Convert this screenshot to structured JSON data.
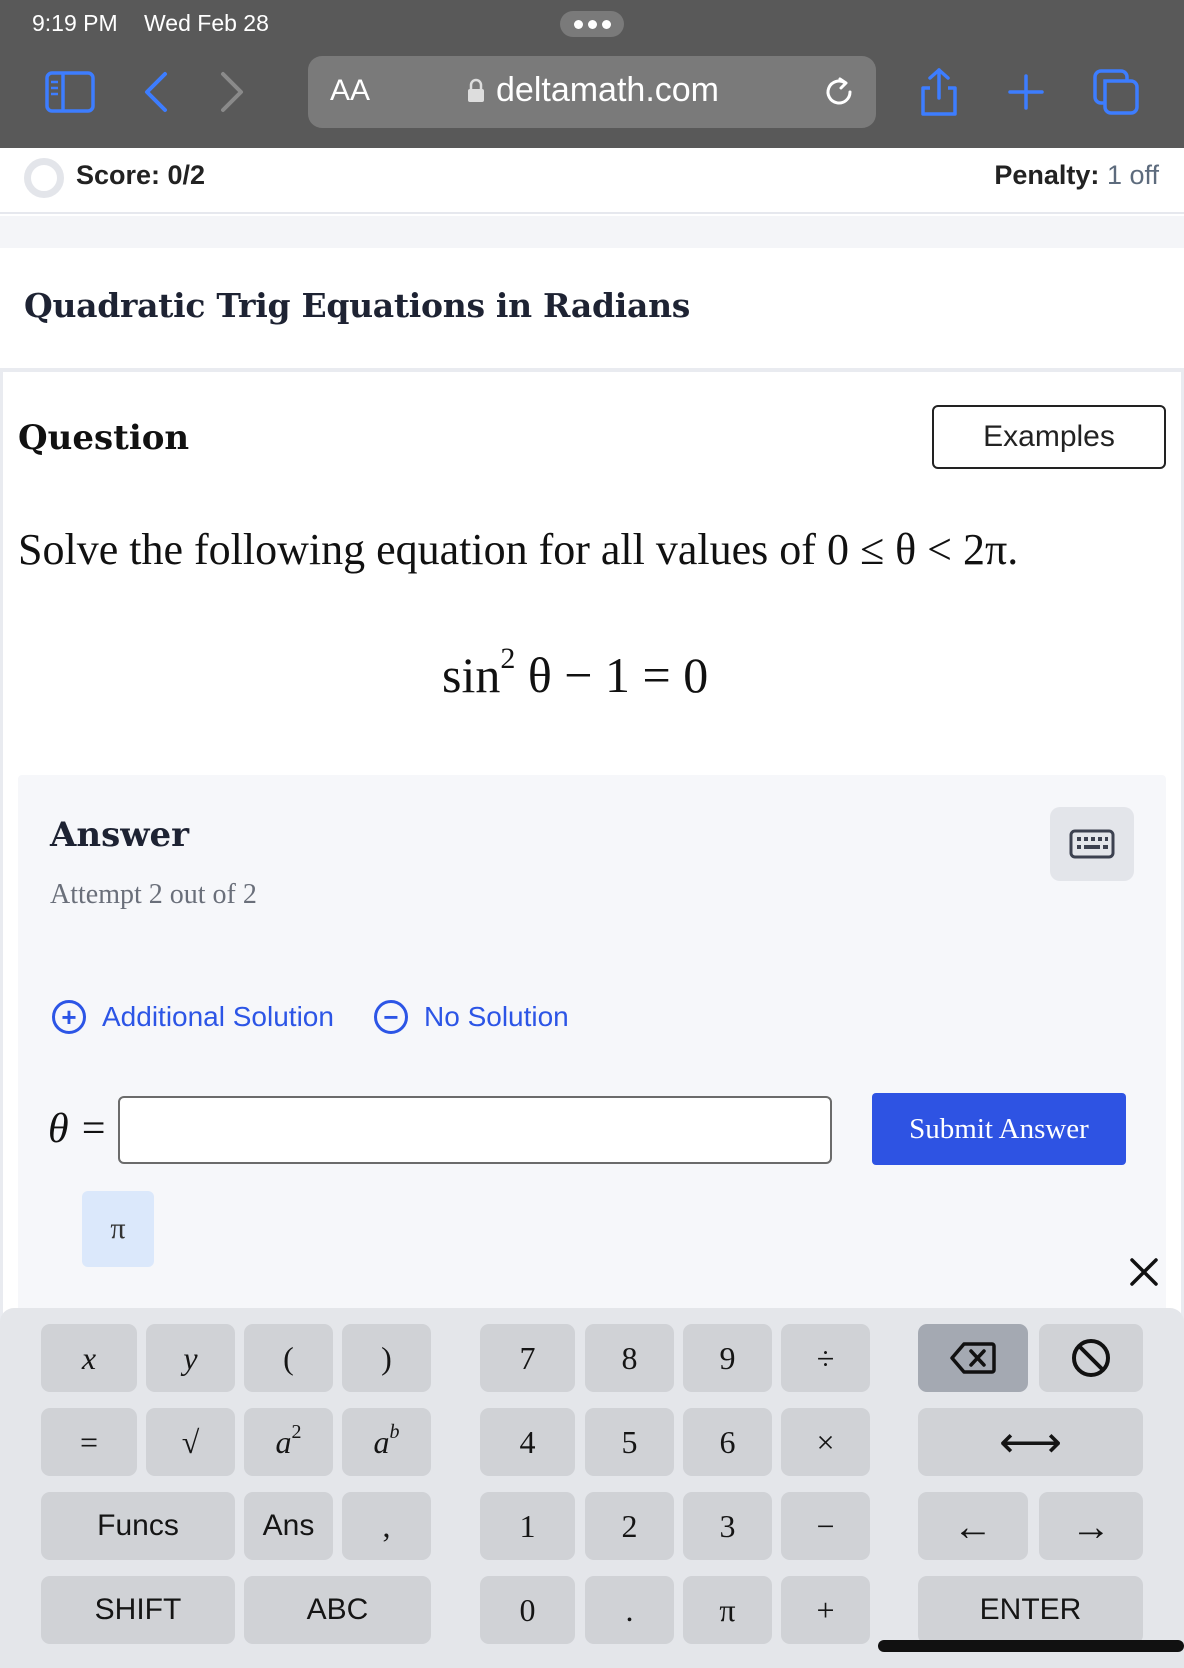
{
  "status": {
    "time": "9:19 PM",
    "date": "Wed Feb 28"
  },
  "browser": {
    "reader_label": "AA",
    "url": "deltamath.com"
  },
  "scorebar": {
    "score": "Score: 0/2",
    "penalty_label": "Penalty:",
    "penalty_value": "1 off"
  },
  "page": {
    "title": "Quadratic Trig Equations in Radians"
  },
  "question": {
    "heading": "Question",
    "examples_label": "Examples",
    "prompt_text": "Solve the following equation for all values of ",
    "prompt_math": "0 ≤ θ < 2π.",
    "equation_sin": "sin",
    "equation_exp": "2",
    "equation_rest": "θ − 1 = 0"
  },
  "answer": {
    "heading": "Answer",
    "attempt": "Attempt 2 out of 2",
    "additional_solution": "Additional Solution",
    "no_solution": "No Solution",
    "theta_label": "θ =",
    "input_value": "",
    "submit_label": "Submit Answer",
    "pi_chip": "π"
  },
  "keyboard": {
    "x": "x",
    "y": "y",
    "lparen": "(",
    "rparen": ")",
    "k7": "7",
    "k8": "8",
    "k9": "9",
    "divide": "÷",
    "equals": "=",
    "sqrt": "√",
    "a_base": "a",
    "a_sq_exp": "2",
    "b_exp": "b",
    "k4": "4",
    "k5": "5",
    "k6": "6",
    "times": "×",
    "funcs": "Funcs",
    "ans": "Ans",
    "comma": ",",
    "k1": "1",
    "k2": "2",
    "k3": "3",
    "minus": "−",
    "shift": "SHIFT",
    "abc": "ABC",
    "k0": "0",
    "dot": ".",
    "pi": "π",
    "plus": "+",
    "enter": "ENTER",
    "left_right_arrow": "⟷",
    "left_arrow": "←",
    "right_arrow": "→"
  },
  "colors": {
    "accent": "#2e53e3",
    "link": "#2c55e6",
    "chrome": "#595959"
  }
}
